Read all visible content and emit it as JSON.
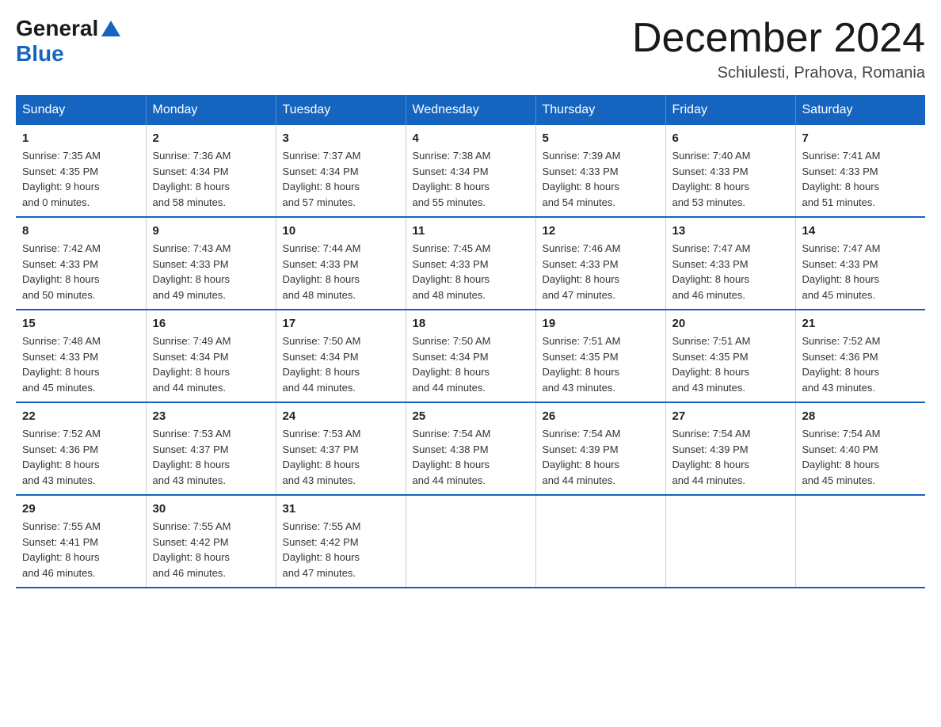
{
  "logo": {
    "general": "General",
    "blue": "Blue"
  },
  "title": "December 2024",
  "location": "Schiulesti, Prahova, Romania",
  "days_of_week": [
    "Sunday",
    "Monday",
    "Tuesday",
    "Wednesday",
    "Thursday",
    "Friday",
    "Saturday"
  ],
  "weeks": [
    [
      {
        "day": "1",
        "sunrise": "7:35 AM",
        "sunset": "4:35 PM",
        "daylight": "9 hours and 0 minutes."
      },
      {
        "day": "2",
        "sunrise": "7:36 AM",
        "sunset": "4:34 PM",
        "daylight": "8 hours and 58 minutes."
      },
      {
        "day": "3",
        "sunrise": "7:37 AM",
        "sunset": "4:34 PM",
        "daylight": "8 hours and 57 minutes."
      },
      {
        "day": "4",
        "sunrise": "7:38 AM",
        "sunset": "4:34 PM",
        "daylight": "8 hours and 55 minutes."
      },
      {
        "day": "5",
        "sunrise": "7:39 AM",
        "sunset": "4:33 PM",
        "daylight": "8 hours and 54 minutes."
      },
      {
        "day": "6",
        "sunrise": "7:40 AM",
        "sunset": "4:33 PM",
        "daylight": "8 hours and 53 minutes."
      },
      {
        "day": "7",
        "sunrise": "7:41 AM",
        "sunset": "4:33 PM",
        "daylight": "8 hours and 51 minutes."
      }
    ],
    [
      {
        "day": "8",
        "sunrise": "7:42 AM",
        "sunset": "4:33 PM",
        "daylight": "8 hours and 50 minutes."
      },
      {
        "day": "9",
        "sunrise": "7:43 AM",
        "sunset": "4:33 PM",
        "daylight": "8 hours and 49 minutes."
      },
      {
        "day": "10",
        "sunrise": "7:44 AM",
        "sunset": "4:33 PM",
        "daylight": "8 hours and 48 minutes."
      },
      {
        "day": "11",
        "sunrise": "7:45 AM",
        "sunset": "4:33 PM",
        "daylight": "8 hours and 48 minutes."
      },
      {
        "day": "12",
        "sunrise": "7:46 AM",
        "sunset": "4:33 PM",
        "daylight": "8 hours and 47 minutes."
      },
      {
        "day": "13",
        "sunrise": "7:47 AM",
        "sunset": "4:33 PM",
        "daylight": "8 hours and 46 minutes."
      },
      {
        "day": "14",
        "sunrise": "7:47 AM",
        "sunset": "4:33 PM",
        "daylight": "8 hours and 45 minutes."
      }
    ],
    [
      {
        "day": "15",
        "sunrise": "7:48 AM",
        "sunset": "4:33 PM",
        "daylight": "8 hours and 45 minutes."
      },
      {
        "day": "16",
        "sunrise": "7:49 AM",
        "sunset": "4:34 PM",
        "daylight": "8 hours and 44 minutes."
      },
      {
        "day": "17",
        "sunrise": "7:50 AM",
        "sunset": "4:34 PM",
        "daylight": "8 hours and 44 minutes."
      },
      {
        "day": "18",
        "sunrise": "7:50 AM",
        "sunset": "4:34 PM",
        "daylight": "8 hours and 44 minutes."
      },
      {
        "day": "19",
        "sunrise": "7:51 AM",
        "sunset": "4:35 PM",
        "daylight": "8 hours and 43 minutes."
      },
      {
        "day": "20",
        "sunrise": "7:51 AM",
        "sunset": "4:35 PM",
        "daylight": "8 hours and 43 minutes."
      },
      {
        "day": "21",
        "sunrise": "7:52 AM",
        "sunset": "4:36 PM",
        "daylight": "8 hours and 43 minutes."
      }
    ],
    [
      {
        "day": "22",
        "sunrise": "7:52 AM",
        "sunset": "4:36 PM",
        "daylight": "8 hours and 43 minutes."
      },
      {
        "day": "23",
        "sunrise": "7:53 AM",
        "sunset": "4:37 PM",
        "daylight": "8 hours and 43 minutes."
      },
      {
        "day": "24",
        "sunrise": "7:53 AM",
        "sunset": "4:37 PM",
        "daylight": "8 hours and 43 minutes."
      },
      {
        "day": "25",
        "sunrise": "7:54 AM",
        "sunset": "4:38 PM",
        "daylight": "8 hours and 44 minutes."
      },
      {
        "day": "26",
        "sunrise": "7:54 AM",
        "sunset": "4:39 PM",
        "daylight": "8 hours and 44 minutes."
      },
      {
        "day": "27",
        "sunrise": "7:54 AM",
        "sunset": "4:39 PM",
        "daylight": "8 hours and 44 minutes."
      },
      {
        "day": "28",
        "sunrise": "7:54 AM",
        "sunset": "4:40 PM",
        "daylight": "8 hours and 45 minutes."
      }
    ],
    [
      {
        "day": "29",
        "sunrise": "7:55 AM",
        "sunset": "4:41 PM",
        "daylight": "8 hours and 46 minutes."
      },
      {
        "day": "30",
        "sunrise": "7:55 AM",
        "sunset": "4:42 PM",
        "daylight": "8 hours and 46 minutes."
      },
      {
        "day": "31",
        "sunrise": "7:55 AM",
        "sunset": "4:42 PM",
        "daylight": "8 hours and 47 minutes."
      },
      null,
      null,
      null,
      null
    ]
  ],
  "labels": {
    "sunrise": "Sunrise:",
    "sunset": "Sunset:",
    "daylight": "Daylight:"
  }
}
